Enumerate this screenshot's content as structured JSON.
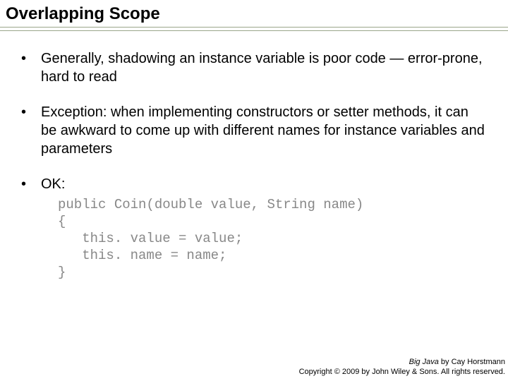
{
  "title": "Overlapping Scope",
  "bullets": [
    "Generally, shadowing an instance variable is poor code — error-prone, hard to read",
    "Exception: when implementing constructors or setter methods, it can be awkward to come up with different names for instance variables and parameters",
    "OK:"
  ],
  "code": "public Coin(double value, String name)\n{\n   this. value = value;\n   this. name = name;\n}",
  "footer": {
    "book": "Big Java",
    "author": " by Cay Horstmann",
    "copyright": "Copyright © 2009 by John Wiley & Sons. All rights reserved."
  }
}
